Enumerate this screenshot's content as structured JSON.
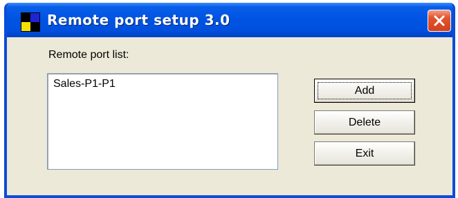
{
  "window": {
    "title": "Remote port setup 3.0",
    "icon": "app-icon",
    "close_icon": "close-icon",
    "accent_color": "#0054e3",
    "close_color": "#d2401d"
  },
  "main": {
    "list_label": "Remote port list:",
    "list_items": [
      "Sales-P1-P1"
    ]
  },
  "buttons": {
    "add_label": "Add",
    "delete_label": "Delete",
    "exit_label": "Exit"
  }
}
